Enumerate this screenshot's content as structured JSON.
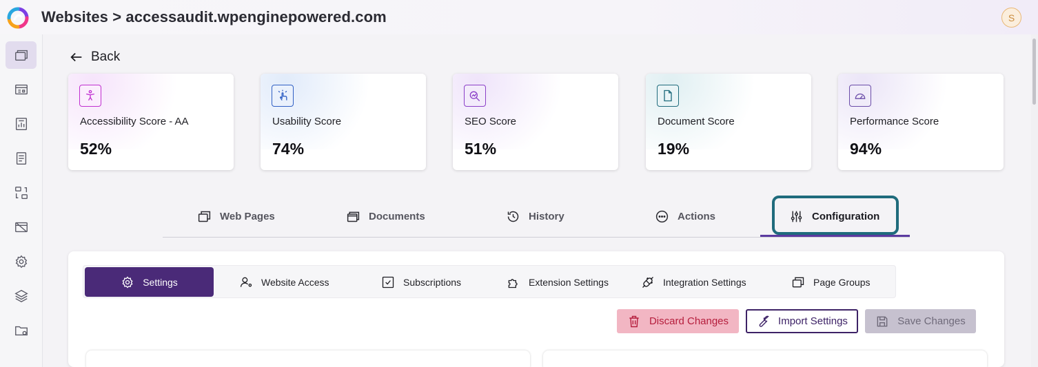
{
  "header": {
    "title": "Websites > accessaudit.wpenginepowered.com",
    "user_initial": "S"
  },
  "sidebar": {
    "items": [
      {
        "icon": "websites-icon",
        "active": true
      },
      {
        "icon": "dashboard-icon",
        "active": false
      },
      {
        "icon": "reports-icon",
        "active": false
      },
      {
        "icon": "document-icon",
        "active": false
      },
      {
        "icon": "sync-icon",
        "active": false
      },
      {
        "icon": "image-off-icon",
        "active": false
      },
      {
        "icon": "gear-icon",
        "active": false
      },
      {
        "icon": "layers-icon",
        "active": false
      },
      {
        "icon": "folder-settings-icon",
        "active": false
      }
    ]
  },
  "back": {
    "label": "Back"
  },
  "scores": [
    {
      "label": "Accessibility Score - AA",
      "value": "52%",
      "icon": "accessibility-icon",
      "color": "#c02fd0"
    },
    {
      "label": "Usability Score",
      "value": "74%",
      "icon": "touch-icon",
      "color": "#2f5fc4"
    },
    {
      "label": "SEO Score",
      "value": "51%",
      "icon": "seo-icon",
      "color": "#8a3ec8"
    },
    {
      "label": "Document Score",
      "value": "19%",
      "icon": "document-icon",
      "color": "#1f6b7c"
    },
    {
      "label": "Performance Score",
      "value": "94%",
      "icon": "speedometer-icon",
      "color": "#6a4ca8"
    }
  ],
  "tabs": [
    {
      "label": "Web Pages",
      "icon": "pages-icon"
    },
    {
      "label": "Documents",
      "icon": "documents-icon"
    },
    {
      "label": "History",
      "icon": "history-icon"
    },
    {
      "label": "Actions",
      "icon": "more-icon"
    },
    {
      "label": "Configuration",
      "icon": "sliders-icon",
      "active": true
    }
  ],
  "subtabs": [
    {
      "label": "Settings",
      "icon": "gear-icon",
      "active": true
    },
    {
      "label": "Website Access",
      "icon": "user-settings-icon"
    },
    {
      "label": "Subscriptions",
      "icon": "checkbox-icon"
    },
    {
      "label": "Extension Settings",
      "icon": "puzzle-icon"
    },
    {
      "label": "Integration Settings",
      "icon": "plug-icon"
    },
    {
      "label": "Page Groups",
      "icon": "pages-icon"
    }
  ],
  "actions": {
    "discard": "Discard Changes",
    "import": "Import Settings",
    "save": "Save Changes"
  },
  "colors": {
    "accent": "#4a2a78",
    "focus": "#1f6b7c",
    "danger": "#b51d3c"
  }
}
